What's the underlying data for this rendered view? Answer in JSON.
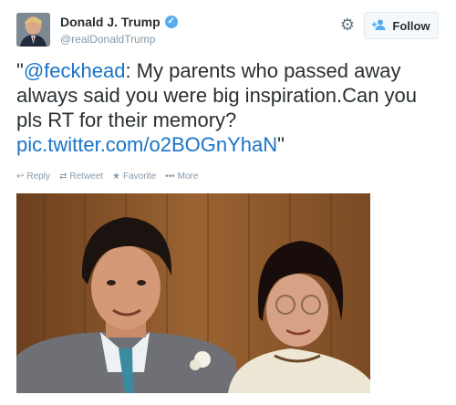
{
  "user": {
    "name": "Donald J. Trump",
    "handle": "@realDonaldTrump"
  },
  "header": {
    "follow_label": "Follow",
    "settings_icon": "gear-icon",
    "follow_icon": "add-user-icon"
  },
  "tweet": {
    "text_prefix": "\"",
    "mention": "@feckhead",
    "text_body": ":  My parents who passed away always said you were big inspiration.Can you pls RT for their memory?",
    "link": "pic.twitter.com/o2BOGnYhaN",
    "text_suffix": "\""
  },
  "actions": {
    "reply": "Reply",
    "retweet": "Retweet",
    "favorite": "Favorite",
    "more": "More"
  },
  "colors": {
    "link": "#1a73c8",
    "verified": "#55acee",
    "muted": "#8899a6"
  }
}
